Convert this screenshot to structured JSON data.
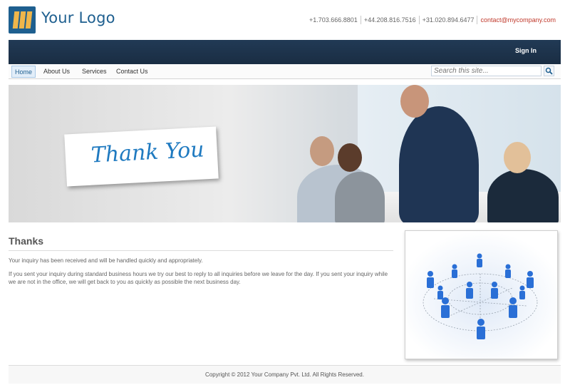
{
  "header": {
    "logo_text": "Your Logo",
    "phones": [
      "+1.703.666.8801",
      "+44.208.816.7516",
      "+31.020.894.6477"
    ],
    "email": "contact@mycompany.com"
  },
  "topbar": {
    "signin_label": "Sign In"
  },
  "nav": {
    "items": [
      {
        "label": "Home",
        "active": true
      },
      {
        "label": "About Us",
        "active": false
      },
      {
        "label": "Services",
        "active": false
      },
      {
        "label": "Contact Us",
        "active": false
      }
    ],
    "search_placeholder": "Search this site..."
  },
  "hero": {
    "card_text": "Thank You"
  },
  "content": {
    "title": "Thanks",
    "para1": "Your inquiry has been received and will be handled quickly and appropriately.",
    "para2": "If you sent your inquiry during standard business hours we try our best to reply to all inquiries before we leave for the day. If you sent your inquiry while we are not in the office, we will get back to you as quickly as possible the next business day."
  },
  "footer": {
    "copyright": "Copyright © 2012 Your Company Pvt. Ltd. All Rights Reserved."
  },
  "colors": {
    "brand_blue": "#1e5f8f",
    "logo_gold": "#f0b64a",
    "topbar_navy": "#1a2d43",
    "email_red": "#c0392b",
    "figure_blue": "#2a6fd6"
  },
  "icons": {
    "search": "search-icon",
    "logo": "logo-icon"
  }
}
